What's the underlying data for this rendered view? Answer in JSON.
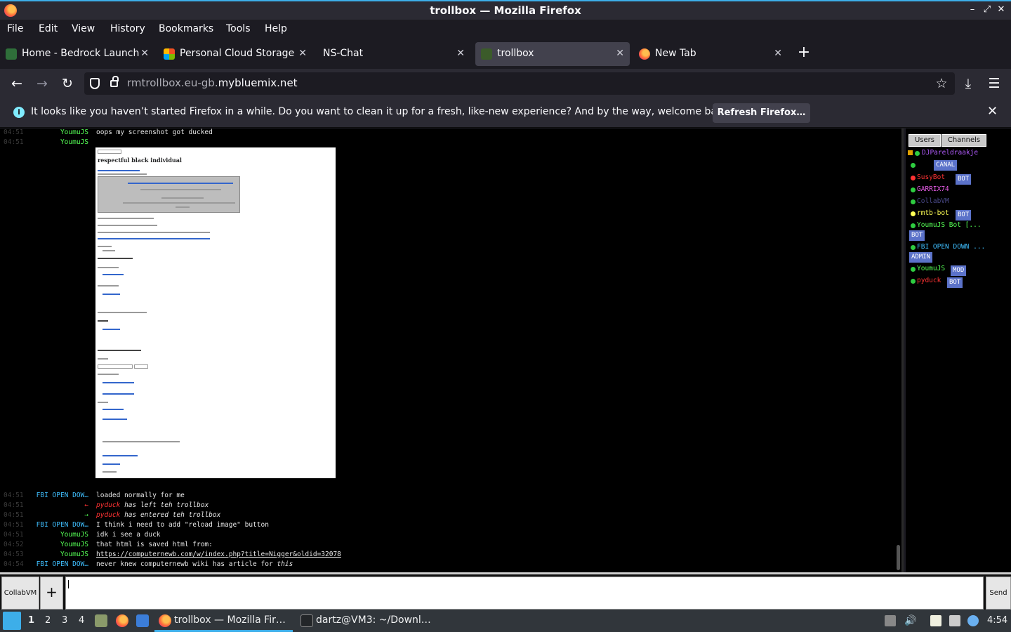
{
  "window": {
    "title": "trollbox — Mozilla Firefox"
  },
  "menu": [
    "File",
    "Edit",
    "View",
    "History",
    "Bookmarks",
    "Tools",
    "Help"
  ],
  "tabs": [
    {
      "label": "Home - Bedrock Launche"
    },
    {
      "label": "Personal Cloud Storage -"
    },
    {
      "label": "NS-Chat"
    },
    {
      "label": "trollbox"
    },
    {
      "label": "New Tab"
    }
  ],
  "url": {
    "subdomain": "rmtrollbox.eu-gb.",
    "domain": "mybluemix.net"
  },
  "notification": {
    "message": "It looks like you haven’t started Firefox in a while. Do you want to clean it up for a fresh, like-new experience? And by the way, welcome back!",
    "button": "Refresh Firefox…"
  },
  "colors": {
    "green": "#55ff55",
    "cyan": "#3fbfff",
    "red": "#ff3333",
    "yellow": "#ffff55",
    "purple": "#b35cff",
    "badge": "#5b72c9"
  },
  "messages_top": [
    {
      "time": "04:51",
      "nick": "YoumuJS",
      "text": "oops my screenshot got ducked"
    },
    {
      "time": "04:51",
      "nick": "YoumuJS",
      "text": ""
    }
  ],
  "screenshot": {
    "heading": "respectful black individual"
  },
  "messages": [
    {
      "time": "04:51",
      "nick": "FBI OPEN DOW…",
      "text": "loaded normally for me",
      "style": "normal"
    },
    {
      "time": "04:51",
      "nick": "←",
      "user": "pyduck",
      "text": "has left teh trollbox",
      "style": "event"
    },
    {
      "time": "04:51",
      "nick": "→",
      "user": "pyduck",
      "text": "has entered teh trollbox",
      "style": "event"
    },
    {
      "time": "04:51",
      "nick": "FBI OPEN DOW…",
      "text": "I think i need to add \"reload image\" button",
      "style": "normal"
    },
    {
      "time": "04:51",
      "nick": "YoumuJS",
      "text": "idk i see a duck",
      "style": "normal"
    },
    {
      "time": "04:52",
      "nick": "YoumuJS",
      "text": "that html is saved html from:",
      "style": "normal"
    },
    {
      "time": "04:53",
      "nick": "YoumuJS",
      "text": "https://computernewb.com/w/index.php?title=Nigger&oldid=32078",
      "style": "link"
    },
    {
      "time": "04:54",
      "nick": "FBI OPEN DOW…",
      "text": "never knew computernewb wiki has article for",
      "emph": "this",
      "style": "normal"
    }
  ],
  "sidebar": {
    "tabs": [
      "Users",
      "Channels"
    ],
    "users": [
      {
        "name": "DJPareldraakje",
        "color": "#b35cff",
        "dot": "#2ecc40",
        "badge": ""
      },
      {
        "name": "",
        "color": "#3333ff",
        "dot": "#2ecc40",
        "badge": "CANAL"
      },
      {
        "name": "SusyBot",
        "color": "#ff3333",
        "dot": "#ff3333",
        "badge": "BOT"
      },
      {
        "name": "GARRIX74",
        "color": "#e85ce8",
        "dot": "#2ecc40",
        "badge": ""
      },
      {
        "name": "CollabVM",
        "color": "#4a4a8a",
        "dot": "#2ecc40",
        "badge": ""
      },
      {
        "name": "rmtb-bot",
        "color": "#ffff55",
        "dot": "#ffff55",
        "badge": "BOT"
      },
      {
        "name": "YoumuJS Bot [...",
        "color": "#55ff55",
        "dot": "#2ecc40",
        "badge": "BOT"
      },
      {
        "name": "FBI OPEN DOWN ...",
        "color": "#3fbfff",
        "dot": "#2ecc40",
        "badge": "ADMIN"
      },
      {
        "name": "YoumuJS",
        "color": "#55ff55",
        "dot": "#2ecc40",
        "badge": "MOD"
      },
      {
        "name": "pyduck",
        "color": "#ff3333",
        "dot": "#2ecc40",
        "badge": "BOT"
      }
    ]
  },
  "input": {
    "channel_button": "CollabVM",
    "add_button": "+",
    "send_button": "Send"
  },
  "taskbar": {
    "workspaces": [
      "1",
      "2",
      "3",
      "4"
    ],
    "tasks": [
      "trollbox — Mozilla Fir…",
      "dartz@VM3: ~/Downl…"
    ],
    "clock": "4:54"
  }
}
